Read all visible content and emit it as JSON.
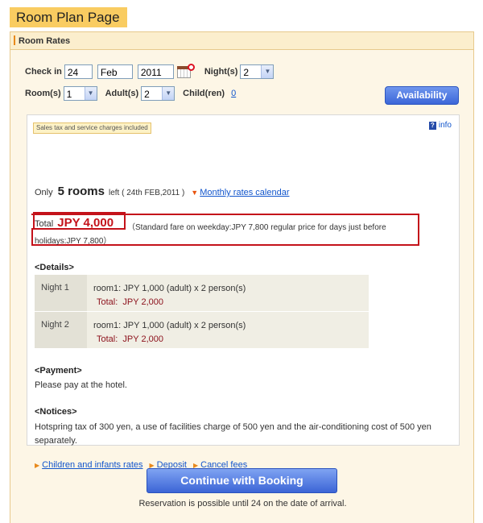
{
  "page_label": "Room Plan Page",
  "panel": {
    "title": "Room Rates"
  },
  "form": {
    "checkin_label": "Check in",
    "day": "24",
    "month": "Feb",
    "year": "2011",
    "nights_label": "Night(s)",
    "nights": "2",
    "rooms_label": "Room(s)",
    "rooms": "1",
    "adults_label": "Adult(s)",
    "adults": "2",
    "children_label": "Child(ren)",
    "children": "0",
    "availability_button": "Availability"
  },
  "notice": {
    "tax": "Sales tax and service charges included",
    "info": "info"
  },
  "availability": {
    "prefix": "Only",
    "rooms": "5 rooms",
    "left": "left ( 24th FEB,2011 )",
    "calendar_link": "Monthly rates calendar"
  },
  "total": {
    "label": "Total",
    "price": "JPY 4,000",
    "fare_line1": "（Standard fare on weekday:JPY 7,800 regular price for days just before",
    "fare_line2": "holidays:JPY 7,800）"
  },
  "details": {
    "heading": "<Details>",
    "nights": [
      {
        "label": "Night 1",
        "detail": "room1: JPY 1,000 (adult) x 2 person(s)",
        "total_label": "Total:",
        "total": "JPY 2,000"
      },
      {
        "label": "Night 2",
        "detail": "room1: JPY 1,000 (adult) x 2 person(s)",
        "total_label": "Total:",
        "total": "JPY 2,000"
      }
    ]
  },
  "payment": {
    "heading": "<Payment>",
    "text": "Please pay at the hotel."
  },
  "notices": {
    "heading": "<Notices>",
    "line1": "Hotspring tax of 300 yen, a use of facilities charge of 500 yen and the air-conditioning cost of 500 yen",
    "line2": "separately."
  },
  "links": {
    "children": "Children and infants rates",
    "deposit": "Deposit",
    "cancel": "Cancel fees"
  },
  "booking": {
    "button": "Continue with Booking",
    "note": "Reservation is possible until 24 on the date of arrival."
  },
  "icons": {
    "calendar": "calendar-icon",
    "info": "info-icon",
    "dropdown": "chevron-down-icon",
    "link_arrow": "triangle-right-icon"
  },
  "colors": {
    "accent": "#f9cc61",
    "price": "#c4121a",
    "button": "#3b66d8",
    "link": "#1155cc"
  }
}
